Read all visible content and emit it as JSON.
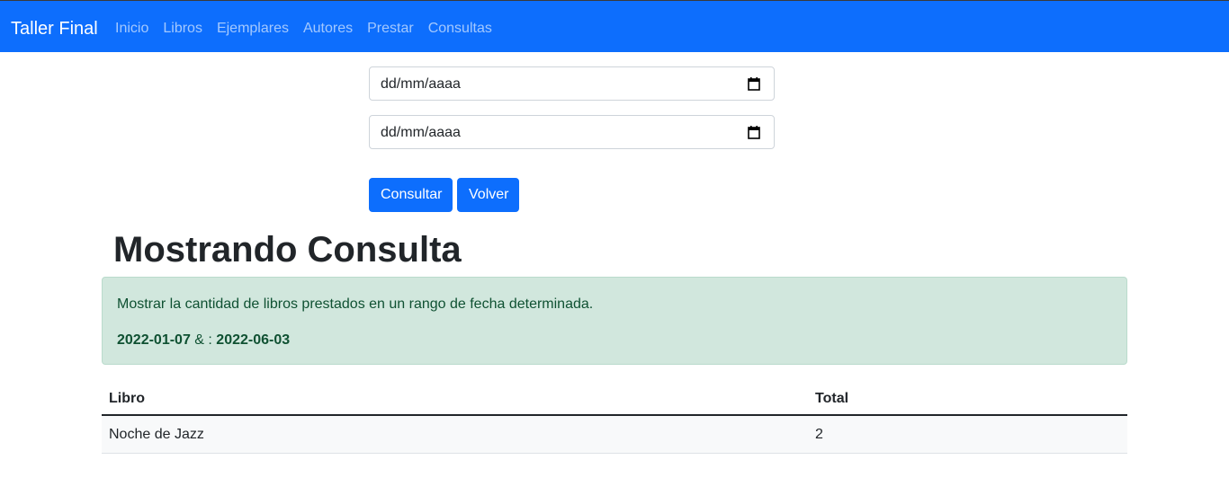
{
  "navbar": {
    "brand": "Taller Final",
    "links": [
      "Inicio",
      "Libros",
      "Ejemplares",
      "Autores",
      "Prestar",
      "Consultas"
    ]
  },
  "form": {
    "date_start_placeholder": "dd/mm/aaaa",
    "date_end_placeholder": "dd/mm/aaaa",
    "consultar_label": "Consultar",
    "volver_label": "Volver"
  },
  "heading": "Mostrando Consulta",
  "alert": {
    "description": "Mostrar la cantidad de libros prestados en un rango de fecha determinada.",
    "date_from": "2022-01-07",
    "separator": " & : ",
    "date_to": "2022-06-03"
  },
  "table": {
    "headers": [
      "Libro",
      "Total"
    ],
    "rows": [
      [
        "Noche de Jazz",
        "2"
      ]
    ]
  },
  "icons": {
    "date_picker": "calendar-icon"
  },
  "colors": {
    "primary": "#0d6efd",
    "success_bg": "#d1e7dd",
    "success_text": "#0f5132"
  }
}
